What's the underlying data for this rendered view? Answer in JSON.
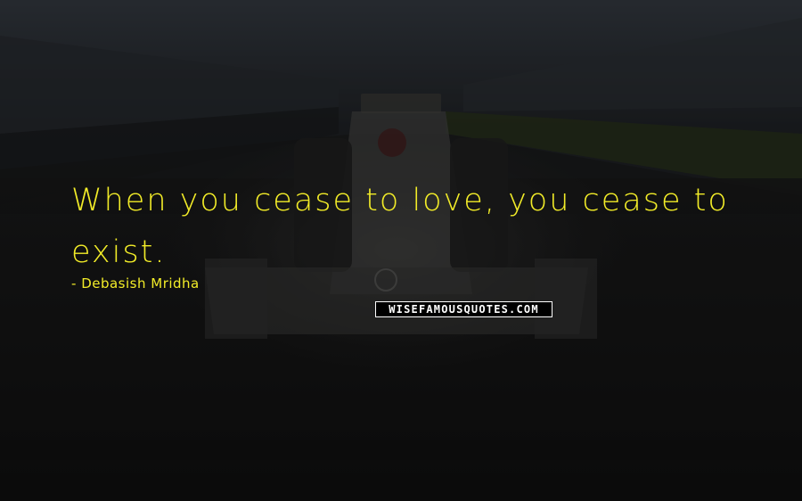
{
  "quote": {
    "text": "When you cease to love, you cease to exist.",
    "author": "Debasish Mridha"
  },
  "watermark": {
    "text": "WISEFAMOUSQUOTES.COM"
  },
  "background": {
    "description_icon": "formula-one-car-photo"
  },
  "colors": {
    "quote_text": "#f2ec28",
    "background": "#161616",
    "watermark_bg": "#000000",
    "watermark_text": "#ffffff"
  }
}
